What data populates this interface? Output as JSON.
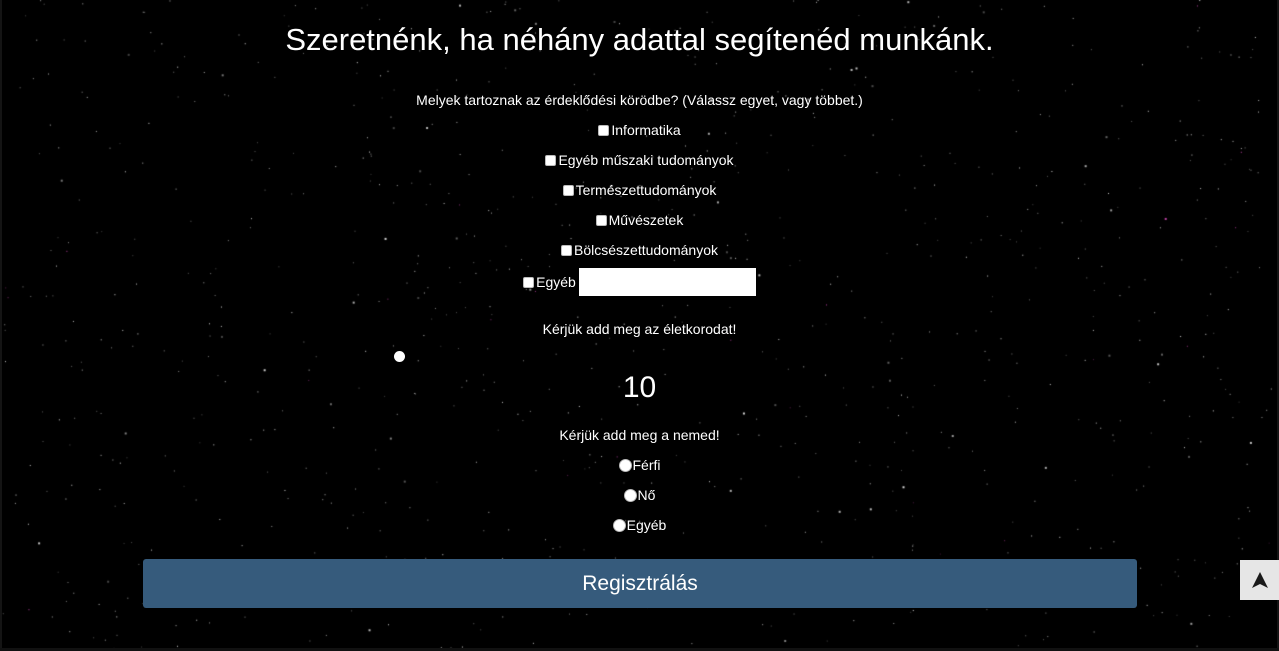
{
  "form": {
    "title": "Szeretnénk, ha néhány adattal segítenéd munkánk.",
    "interests": {
      "question": "Melyek tartoznak az érdeklődési körödbe? (Válassz egyet, vagy többet.)",
      "options": [
        {
          "label": "Informatika"
        },
        {
          "label": "Egyéb műszaki tudományok"
        },
        {
          "label": "Természettudományok"
        },
        {
          "label": "Művészetek"
        },
        {
          "label": "Bölcsészettudományok"
        }
      ],
      "other_label": "Egyéb",
      "other_value": ""
    },
    "age": {
      "question": "Kérjük add meg az életkorodat!",
      "value": "10"
    },
    "gender": {
      "question": "Kérjük add meg a nemed!",
      "options": [
        {
          "label": "Férfi"
        },
        {
          "label": "Nő"
        },
        {
          "label": "Egyéb"
        }
      ]
    },
    "submit_label": "Regisztrálás"
  },
  "scroll_top_icon": "arrow-up-icon",
  "colors": {
    "background": "#000000",
    "button": "#365b7c",
    "text": "#ffffff"
  }
}
